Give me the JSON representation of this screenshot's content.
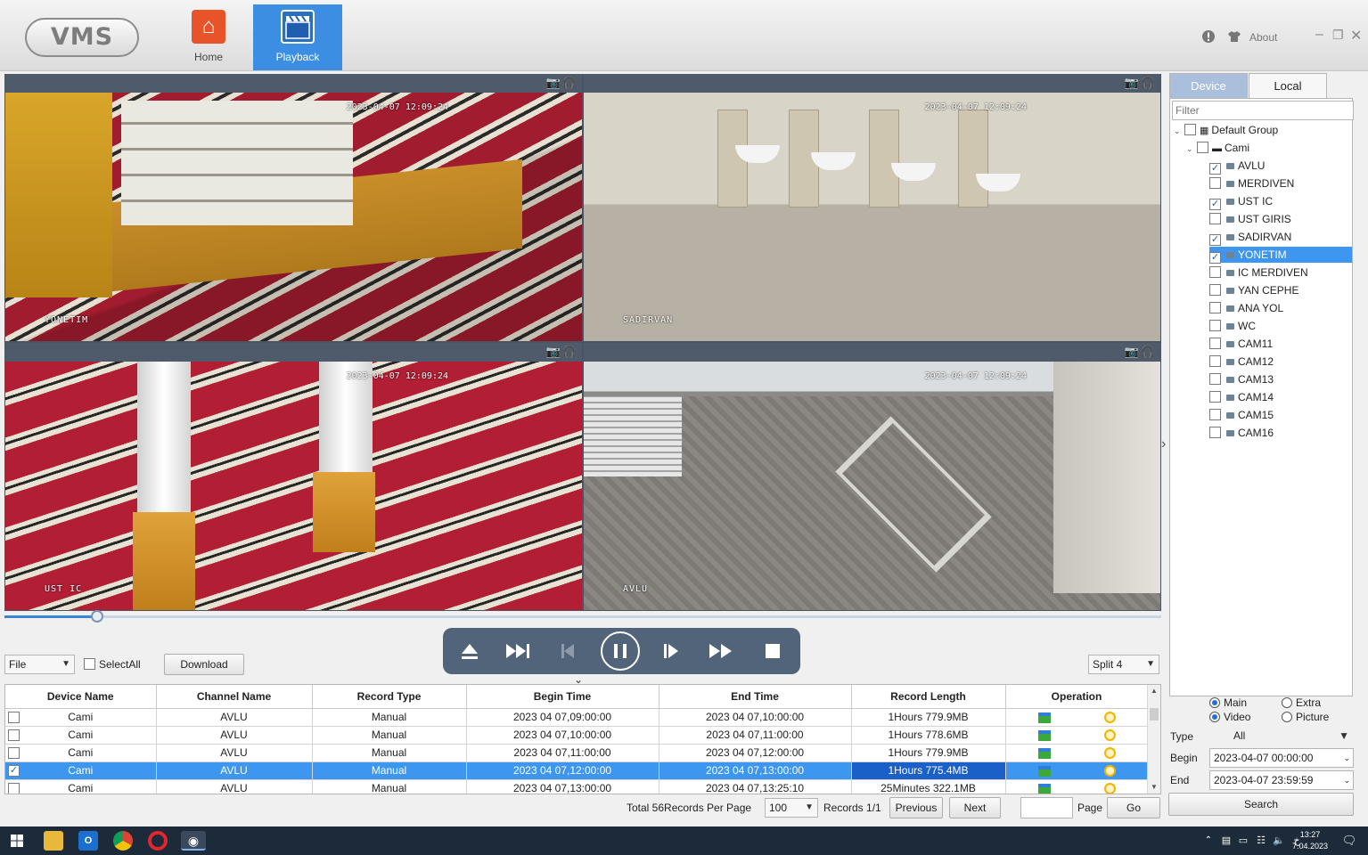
{
  "app": {
    "logo": "VMS"
  },
  "nav": [
    {
      "label": "Home",
      "icon": "home-icon"
    },
    {
      "label": "Playback",
      "icon": "clapper-icon"
    }
  ],
  "topright": {
    "about_label": "About"
  },
  "videos": [
    {
      "osd": "YONETIM",
      "timestamp": "2023-04-07 12:09:24"
    },
    {
      "osd": "SADIRVAN",
      "timestamp": "2023-04-07 12:09:24"
    },
    {
      "osd": "UST IC",
      "timestamp": "2023-04-07 12:09:24"
    },
    {
      "osd": "AVLU",
      "timestamp": "2023-04-07 12:09:24"
    }
  ],
  "playback": {
    "progress_fraction": 0.08
  },
  "toolbar": {
    "file_select": "File",
    "selectall_label": "SelectAll",
    "download_label": "Download",
    "split_select": "Split 4"
  },
  "table": {
    "headers": [
      "Device Name",
      "Channel Name",
      "Record Type",
      "Begin Time",
      "End Time",
      "Record Length",
      "Operation"
    ],
    "rows": [
      {
        "checked": false,
        "device": "Cami",
        "channel": "AVLU",
        "type": "Manual",
        "begin": "2023 04 07,09:00:00",
        "end": "2023 04 07,10:00:00",
        "length": "1Hours 779.9MB"
      },
      {
        "checked": false,
        "device": "Cami",
        "channel": "AVLU",
        "type": "Manual",
        "begin": "2023 04 07,10:00:00",
        "end": "2023 04 07,11:00:00",
        "length": "1Hours 778.6MB"
      },
      {
        "checked": false,
        "device": "Cami",
        "channel": "AVLU",
        "type": "Manual",
        "begin": "2023 04 07,11:00:00",
        "end": "2023 04 07,12:00:00",
        "length": "1Hours 779.9MB"
      },
      {
        "checked": true,
        "device": "Cami",
        "channel": "AVLU",
        "type": "Manual",
        "begin": "2023 04 07,12:00:00",
        "end": "2023 04 07,13:00:00",
        "length": "1Hours 775.4MB"
      },
      {
        "checked": false,
        "device": "Cami",
        "channel": "AVLU",
        "type": "Manual",
        "begin": "2023 04 07,13:00:00",
        "end": "2023 04 07,13:25:10",
        "length": "25Minutes 322.1MB"
      }
    ]
  },
  "pager": {
    "total_label": "Total 56Records Per Page",
    "per_page": "100",
    "records_label": "Records 1/1",
    "previous_label": "Previous",
    "next_label": "Next",
    "page_label": "Page",
    "go_label": "Go"
  },
  "panel": {
    "tab_device": "Device",
    "tab_local": "Local",
    "filter_placeholder": "Filter",
    "root_group": "Default Group",
    "device_node": "Cami",
    "channels": [
      {
        "name": "AVLU",
        "checked": true
      },
      {
        "name": "MERDIVEN",
        "checked": false
      },
      {
        "name": "UST IC",
        "checked": true
      },
      {
        "name": "UST GIRIS",
        "checked": false
      },
      {
        "name": "SADIRVAN",
        "checked": true
      },
      {
        "name": "YONETIM",
        "checked": true,
        "selected": true
      },
      {
        "name": "IC MERDIVEN",
        "checked": false
      },
      {
        "name": "YAN CEPHE",
        "checked": false
      },
      {
        "name": "ANA YOL",
        "checked": false
      },
      {
        "name": "WC",
        "checked": false
      },
      {
        "name": "CAM11",
        "checked": false
      },
      {
        "name": "CAM12",
        "checked": false
      },
      {
        "name": "CAM13",
        "checked": false
      },
      {
        "name": "CAM14",
        "checked": false
      },
      {
        "name": "CAM15",
        "checked": false
      },
      {
        "name": "CAM16",
        "checked": false
      }
    ],
    "stream_main": "Main",
    "stream_extra": "Extra",
    "media_video": "Video",
    "media_picture": "Picture",
    "type_label": "Type",
    "type_value": "All",
    "begin_label": "Begin",
    "begin_value": "2023-04-07 00:00:00",
    "end_label": "End",
    "end_value": "2023-04-07 23:59:59",
    "search_label": "Search"
  },
  "taskbar": {
    "time": "13:27",
    "date": "7.04.2023"
  }
}
